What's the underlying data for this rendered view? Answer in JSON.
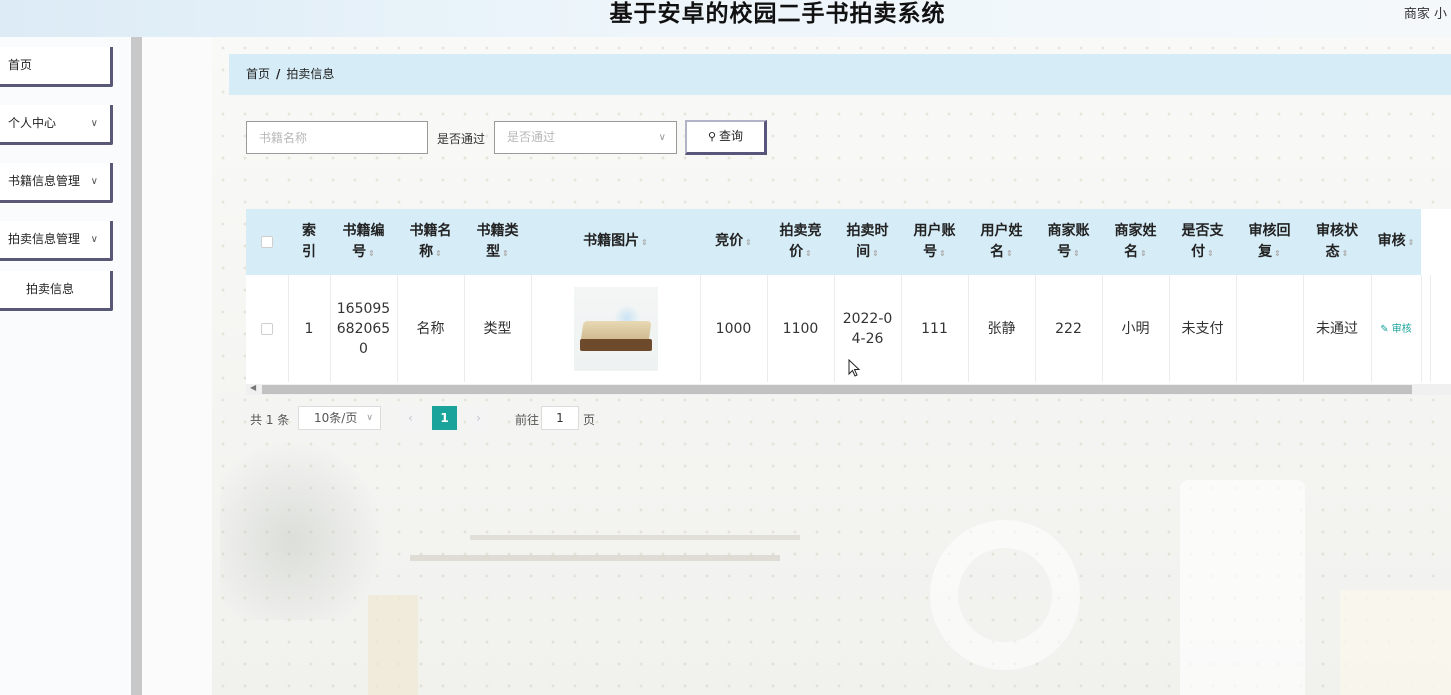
{
  "header": {
    "title": "基于安卓的校园二手书拍卖系统",
    "user_label": "商家 小"
  },
  "sidebar": {
    "items": [
      {
        "label": "首页",
        "has_chevron": false
      },
      {
        "label": "个人中心",
        "has_chevron": true
      },
      {
        "label": "书籍信息管理",
        "has_chevron": true
      },
      {
        "label": "拍卖信息管理",
        "has_chevron": true
      },
      {
        "label": "拍卖信息",
        "has_chevron": false
      }
    ],
    "chevron_glyph": "∨"
  },
  "breadcrumb": {
    "home": "首页",
    "separator": "/",
    "current": "拍卖信息"
  },
  "search": {
    "name_placeholder": "书籍名称",
    "filter_label": "是否通过",
    "filter_placeholder": "是否通过",
    "button_label": "查询",
    "button_icon": "search-icon"
  },
  "table": {
    "columns": [
      "索引",
      "书籍编号",
      "书籍名称",
      "书籍类型",
      "书籍图片",
      "竞价",
      "拍卖竞价",
      "拍卖时间",
      "用户账号",
      "用户姓名",
      "商家账号",
      "商家姓名",
      "是否支付",
      "审核回复",
      "审核状态",
      "审核"
    ],
    "header_lines": {
      "c1a": "索",
      "c1b": "引",
      "c2a": "书籍编",
      "c2b": "号",
      "c3a": "书籍名",
      "c3b": "称",
      "c4a": "书籍类",
      "c4b": "型",
      "c5": "书籍图片",
      "c6": "竞价",
      "c7a": "拍卖竞",
      "c7b": "价",
      "c8a": "拍卖时",
      "c8b": "间",
      "c9a": "用户账",
      "c9b": "号",
      "c10a": "用户姓",
      "c10b": "名",
      "c11a": "商家账",
      "c11b": "号",
      "c12a": "商家姓",
      "c12b": "名",
      "c13a": "是否支",
      "c13b": "付",
      "c14a": "审核回",
      "c14b": "复",
      "c15a": "审核状",
      "c15b": "态",
      "c16": "审核"
    },
    "sort_glyph": "⇕",
    "rows": [
      {
        "index": "1",
        "book_no_l1": "165095",
        "book_no_l2": "682065",
        "book_no_l3": "0",
        "book_name": "名称",
        "book_type": "类型",
        "price": "1000",
        "auction_price": "1100",
        "auction_time_l1": "2022-0",
        "auction_time_l2": "4-26",
        "user_account": "111",
        "user_name": "张静",
        "merchant_account": "222",
        "merchant_name": "小明",
        "paid": "未支付",
        "review_reply": "",
        "review_status": "未通过",
        "review_action": "✎ 审核"
      }
    ]
  },
  "pagination": {
    "total": "共 1 条",
    "page_size": "10条/页",
    "prev": "‹",
    "current_page": "1",
    "next": "›",
    "goto_prefix": "前往",
    "goto_value": "1",
    "goto_suffix": "页"
  },
  "colors": {
    "accent": "#1aa39a",
    "header_bg": "#d6ecf7",
    "menu_border": "#5a5877"
  }
}
